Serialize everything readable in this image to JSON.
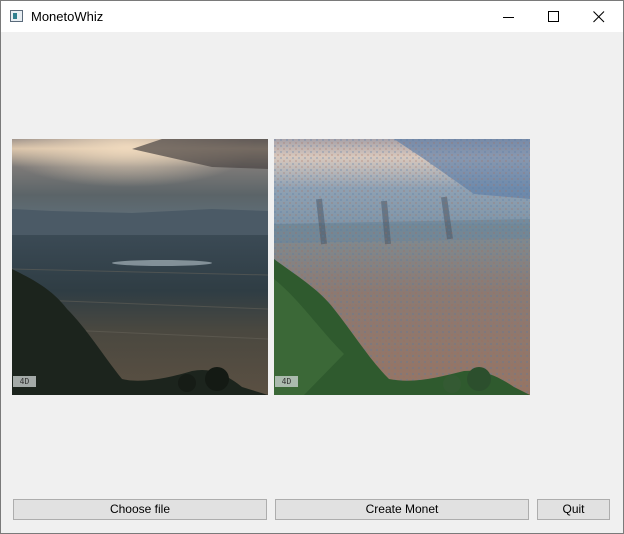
{
  "window": {
    "title": "MonetoWhiz",
    "app_icon": "app-window-icon",
    "controls": [
      "minimize-icon",
      "maximize-icon",
      "close-icon"
    ]
  },
  "images": {
    "original": {
      "watermark": "4D"
    },
    "monet": {
      "watermark": "4D"
    }
  },
  "buttons": {
    "choose_file": "Choose file",
    "create_monet": "Create Monet",
    "quit": "Quit"
  },
  "colors": {
    "window_bg": "#f0f0f0",
    "button_bg": "#e1e1e1",
    "button_border": "#adadad"
  }
}
